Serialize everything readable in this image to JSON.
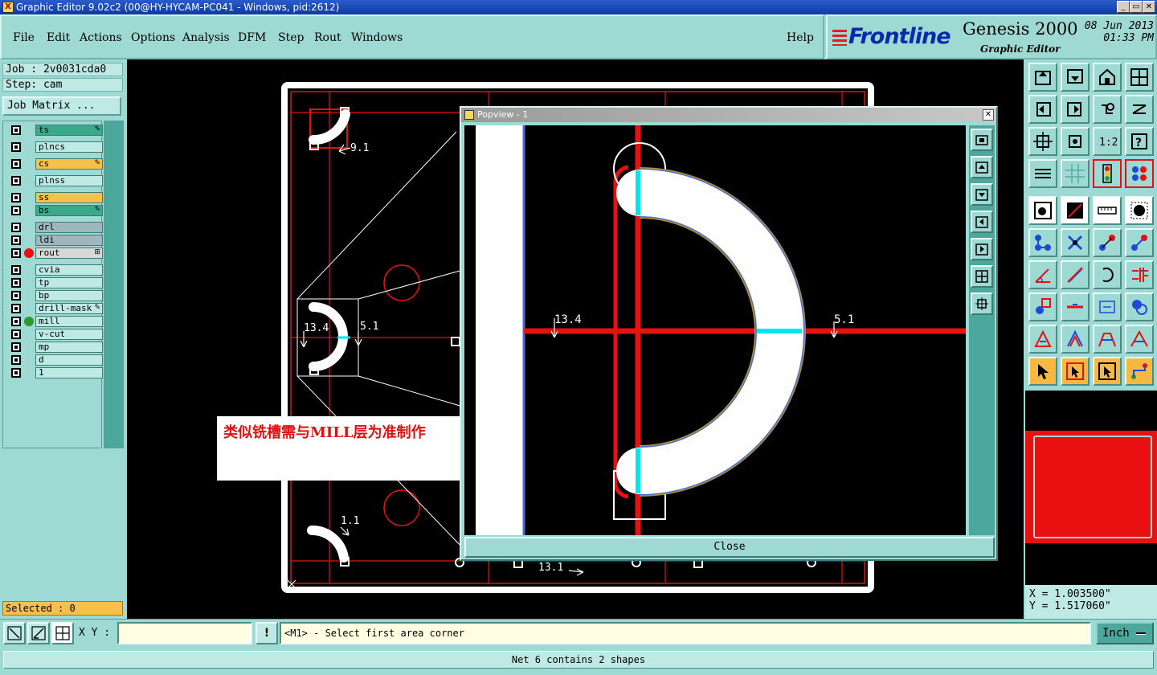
{
  "window": {
    "title": "Graphic Editor 9.02c2 (00@HY-HYCAM-PC041 - Windows, pid:2612)",
    "app_icon": "X",
    "min_glyph": "_",
    "max_glyph": "▭",
    "close_glyph": "✕"
  },
  "menu": [
    {
      "label": "File",
      "name": "menu-file"
    },
    {
      "label": "Edit",
      "name": "menu-edit"
    },
    {
      "label": "Actions",
      "name": "menu-actions"
    },
    {
      "label": "Options",
      "name": "menu-options"
    },
    {
      "label": "Analysis",
      "name": "menu-analysis"
    },
    {
      "label": "DFM",
      "name": "menu-dfm"
    },
    {
      "label": "Step",
      "name": "menu-step"
    },
    {
      "label": "Rout",
      "name": "menu-rout"
    },
    {
      "label": "Windows",
      "name": "menu-windows"
    },
    {
      "label": "Help",
      "name": "menu-help"
    }
  ],
  "brand": {
    "logo": "Frontline",
    "product": "Genesis 2000",
    "subtitle": "Graphic Editor",
    "date": "08 Jun 2013",
    "time": "01:33 PM"
  },
  "job": {
    "job_line": "Job : 2v0031cda0",
    "step_line": "Step: cam",
    "matrix_button": "Job Matrix ..."
  },
  "layers": [
    {
      "name": "ts",
      "color": "#3aa98c",
      "flag": "✎",
      "dot": ""
    },
    {
      "name": "plncs",
      "color": "#bfe9e4",
      "flag": "",
      "dot": ""
    },
    {
      "name": "cs",
      "color": "#f6c14a",
      "flag": "✎",
      "dot": ""
    },
    {
      "name": "plnss",
      "color": "#bfe9e4",
      "flag": "",
      "dot": ""
    },
    {
      "name": "ss",
      "color": "#f6c14a",
      "flag": "",
      "dot": ""
    },
    {
      "name": "bs",
      "color": "#3aa98c",
      "flag": "✎",
      "dot": ""
    },
    {
      "name": "drl",
      "color": "#9fb8be",
      "flag": "",
      "dot": ""
    },
    {
      "name": "ldi",
      "color": "#9fb8be",
      "flag": "",
      "dot": ""
    },
    {
      "name": "rout",
      "color": "#d8d8d8",
      "flag": "⊞",
      "dot": "#e81010"
    },
    {
      "name": "cvia",
      "color": "#bfe9e4",
      "flag": "",
      "dot": ""
    },
    {
      "name": "tp",
      "color": "#bfe9e4",
      "flag": "",
      "dot": ""
    },
    {
      "name": "bp",
      "color": "#bfe9e4",
      "flag": "",
      "dot": ""
    },
    {
      "name": "drill-mask",
      "color": "#bfe9e4",
      "flag": "✎",
      "dot": ""
    },
    {
      "name": "mill",
      "color": "#bfe9e4",
      "flag": "",
      "dot": "#2e9a2e"
    },
    {
      "name": "v-cut",
      "color": "#bfe9e4",
      "flag": "",
      "dot": ""
    },
    {
      "name": "mp",
      "color": "#bfe9e4",
      "flag": "",
      "dot": ""
    },
    {
      "name": "d",
      "color": "#bfe9e4",
      "flag": "",
      "dot": ""
    },
    {
      "name": "1",
      "color": "#bfe9e4",
      "flag": "",
      "dot": ""
    }
  ],
  "selected_label": "Selected : 0",
  "canvas": {
    "labels": [
      "9.1",
      "13.4",
      "5.1",
      "1.1",
      "13.1"
    ],
    "note": "类似铣槽需与MILL层为准制作"
  },
  "popview": {
    "title": "Popview - 1",
    "close_glyph": "✕",
    "labels": [
      "13.4",
      "5.1"
    ],
    "close_button": "Close"
  },
  "coords": {
    "x": "X = 1.003500\"",
    "y": "Y = 1.517060\""
  },
  "bottom": {
    "xy_label": "X Y :",
    "xy_value": "",
    "alert_glyph": "!",
    "prompt": "<M1> - Select first area corner",
    "units": "Inch"
  },
  "status": "Net 6 contains 2 shapes",
  "colors": {
    "accent_teal": "#9fd9d3",
    "canvas_bg": "#000000",
    "feature_red": "#e81010",
    "highlight_cyan": "#00e5ee",
    "title_blue": "#0c3aa6"
  }
}
